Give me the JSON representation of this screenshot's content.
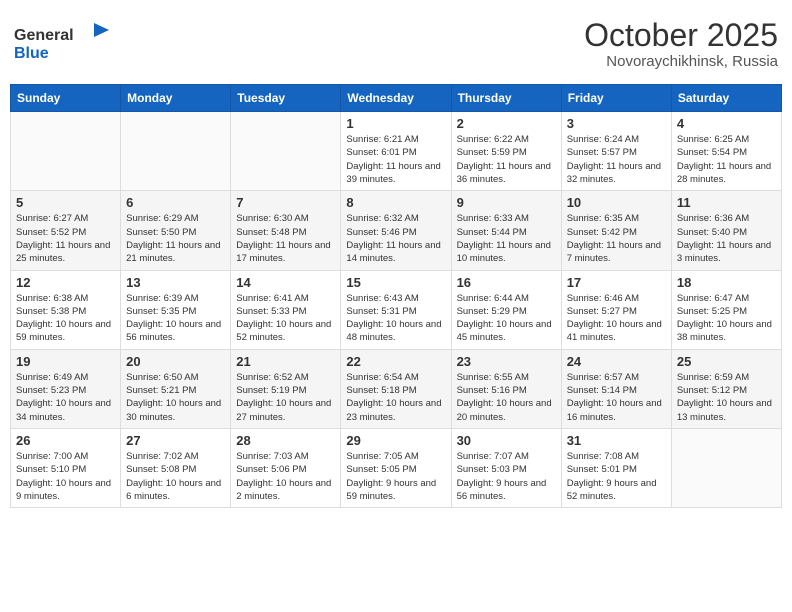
{
  "logo": {
    "text_general": "General",
    "text_blue": "Blue"
  },
  "title": "October 2025",
  "location": "Novoraychikhinsk, Russia",
  "days_of_week": [
    "Sunday",
    "Monday",
    "Tuesday",
    "Wednesday",
    "Thursday",
    "Friday",
    "Saturday"
  ],
  "weeks": [
    [
      {
        "day": "",
        "info": ""
      },
      {
        "day": "",
        "info": ""
      },
      {
        "day": "",
        "info": ""
      },
      {
        "day": "1",
        "info": "Sunrise: 6:21 AM\nSunset: 6:01 PM\nDaylight: 11 hours\nand 39 minutes."
      },
      {
        "day": "2",
        "info": "Sunrise: 6:22 AM\nSunset: 5:59 PM\nDaylight: 11 hours\nand 36 minutes."
      },
      {
        "day": "3",
        "info": "Sunrise: 6:24 AM\nSunset: 5:57 PM\nDaylight: 11 hours\nand 32 minutes."
      },
      {
        "day": "4",
        "info": "Sunrise: 6:25 AM\nSunset: 5:54 PM\nDaylight: 11 hours\nand 28 minutes."
      }
    ],
    [
      {
        "day": "5",
        "info": "Sunrise: 6:27 AM\nSunset: 5:52 PM\nDaylight: 11 hours\nand 25 minutes."
      },
      {
        "day": "6",
        "info": "Sunrise: 6:29 AM\nSunset: 5:50 PM\nDaylight: 11 hours\nand 21 minutes."
      },
      {
        "day": "7",
        "info": "Sunrise: 6:30 AM\nSunset: 5:48 PM\nDaylight: 11 hours\nand 17 minutes."
      },
      {
        "day": "8",
        "info": "Sunrise: 6:32 AM\nSunset: 5:46 PM\nDaylight: 11 hours\nand 14 minutes."
      },
      {
        "day": "9",
        "info": "Sunrise: 6:33 AM\nSunset: 5:44 PM\nDaylight: 11 hours\nand 10 minutes."
      },
      {
        "day": "10",
        "info": "Sunrise: 6:35 AM\nSunset: 5:42 PM\nDaylight: 11 hours\nand 7 minutes."
      },
      {
        "day": "11",
        "info": "Sunrise: 6:36 AM\nSunset: 5:40 PM\nDaylight: 11 hours\nand 3 minutes."
      }
    ],
    [
      {
        "day": "12",
        "info": "Sunrise: 6:38 AM\nSunset: 5:38 PM\nDaylight: 10 hours\nand 59 minutes."
      },
      {
        "day": "13",
        "info": "Sunrise: 6:39 AM\nSunset: 5:35 PM\nDaylight: 10 hours\nand 56 minutes."
      },
      {
        "day": "14",
        "info": "Sunrise: 6:41 AM\nSunset: 5:33 PM\nDaylight: 10 hours\nand 52 minutes."
      },
      {
        "day": "15",
        "info": "Sunrise: 6:43 AM\nSunset: 5:31 PM\nDaylight: 10 hours\nand 48 minutes."
      },
      {
        "day": "16",
        "info": "Sunrise: 6:44 AM\nSunset: 5:29 PM\nDaylight: 10 hours\nand 45 minutes."
      },
      {
        "day": "17",
        "info": "Sunrise: 6:46 AM\nSunset: 5:27 PM\nDaylight: 10 hours\nand 41 minutes."
      },
      {
        "day": "18",
        "info": "Sunrise: 6:47 AM\nSunset: 5:25 PM\nDaylight: 10 hours\nand 38 minutes."
      }
    ],
    [
      {
        "day": "19",
        "info": "Sunrise: 6:49 AM\nSunset: 5:23 PM\nDaylight: 10 hours\nand 34 minutes."
      },
      {
        "day": "20",
        "info": "Sunrise: 6:50 AM\nSunset: 5:21 PM\nDaylight: 10 hours\nand 30 minutes."
      },
      {
        "day": "21",
        "info": "Sunrise: 6:52 AM\nSunset: 5:19 PM\nDaylight: 10 hours\nand 27 minutes."
      },
      {
        "day": "22",
        "info": "Sunrise: 6:54 AM\nSunset: 5:18 PM\nDaylight: 10 hours\nand 23 minutes."
      },
      {
        "day": "23",
        "info": "Sunrise: 6:55 AM\nSunset: 5:16 PM\nDaylight: 10 hours\nand 20 minutes."
      },
      {
        "day": "24",
        "info": "Sunrise: 6:57 AM\nSunset: 5:14 PM\nDaylight: 10 hours\nand 16 minutes."
      },
      {
        "day": "25",
        "info": "Sunrise: 6:59 AM\nSunset: 5:12 PM\nDaylight: 10 hours\nand 13 minutes."
      }
    ],
    [
      {
        "day": "26",
        "info": "Sunrise: 7:00 AM\nSunset: 5:10 PM\nDaylight: 10 hours\nand 9 minutes."
      },
      {
        "day": "27",
        "info": "Sunrise: 7:02 AM\nSunset: 5:08 PM\nDaylight: 10 hours\nand 6 minutes."
      },
      {
        "day": "28",
        "info": "Sunrise: 7:03 AM\nSunset: 5:06 PM\nDaylight: 10 hours\nand 2 minutes."
      },
      {
        "day": "29",
        "info": "Sunrise: 7:05 AM\nSunset: 5:05 PM\nDaylight: 9 hours\nand 59 minutes."
      },
      {
        "day": "30",
        "info": "Sunrise: 7:07 AM\nSunset: 5:03 PM\nDaylight: 9 hours\nand 56 minutes."
      },
      {
        "day": "31",
        "info": "Sunrise: 7:08 AM\nSunset: 5:01 PM\nDaylight: 9 hours\nand 52 minutes."
      },
      {
        "day": "",
        "info": ""
      }
    ]
  ]
}
